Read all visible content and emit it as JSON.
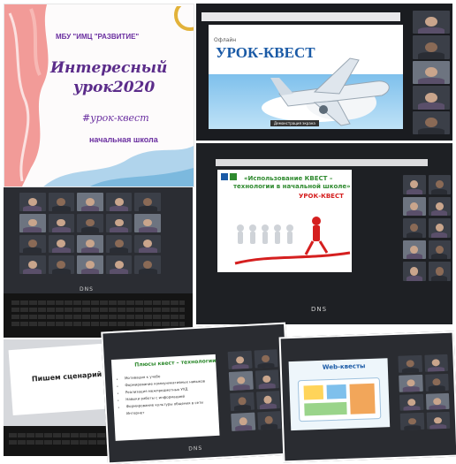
{
  "card": {
    "org": "МБУ \"ИМЦ \"РАЗВИТИЕ\"",
    "title_line1": "Интересный",
    "title_line2": "урок2020",
    "hashtag": "#урок-квест",
    "school": "начальная школа"
  },
  "slide1": {
    "title": "УРОК-КВЕСТ",
    "prefix": "Офлайн",
    "banner_text": "Демонстрация экрана"
  },
  "slide2": {
    "title_line1": "«Использование КВЕСТ –",
    "title_line2": "технологии в начальной школе»",
    "subtitle": "УРОК-КВЕСТ"
  },
  "slide3": {
    "title": "Пишем сценарий"
  },
  "slide4": {
    "title": "Плюсы квест – технологии",
    "bullets": [
      "Мотивация к учебе",
      "Формирование коммуникативных навыков",
      "Реализация межпредметных УУД",
      "Навыки работы с информацией",
      "Формирование культуры общения в сети Интернет"
    ]
  },
  "slide5": {
    "title": "Web-квесты"
  },
  "laptop": {
    "brand": "DNS"
  },
  "colors": {
    "card_title": "#5b2c8a",
    "card_accent": "#6a2fa0",
    "slide_green": "#2f8a2f",
    "slide_red": "#d51f1f",
    "sky": "#6cb3e8"
  }
}
